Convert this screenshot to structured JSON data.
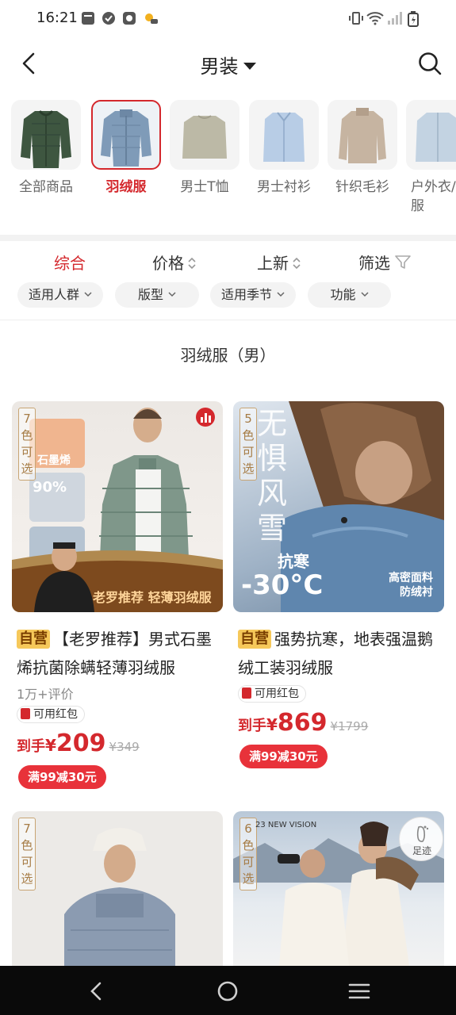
{
  "status_bar": {
    "time": "16:21"
  },
  "header": {
    "title": "男装"
  },
  "categories": [
    {
      "label": "全部商品",
      "active": false
    },
    {
      "label": "羽绒服",
      "active": true
    },
    {
      "label": "男士T恤",
      "active": false
    },
    {
      "label": "男士衬衫",
      "active": false
    },
    {
      "label": "针织毛衫",
      "active": false
    },
    {
      "label": "户外衣/晒服",
      "active": false
    }
  ],
  "sort": {
    "comprehensive": "综合",
    "price": "价格",
    "new": "上新",
    "filter": "筛选"
  },
  "filters": {
    "crowd": "适用人群",
    "fit": "版型",
    "season": "适用季节",
    "function": "功能"
  },
  "section_title": "羽绒服（男）",
  "products": [
    {
      "color_badge": "7色可选",
      "self_operated": "自营",
      "title": "【老罗推荐】男式石墨烯抗菌除螨轻薄羽绒服",
      "reviews": "1万+评价",
      "hongbao": "可用红包",
      "price_prefix": "到手",
      "currency": "¥",
      "price": "209",
      "original_price": "¥349",
      "coupon": "满99减30元",
      "overlay": {
        "graphene": "石墨烯",
        "down_pct": "90%",
        "banner": "老罗推荐 轻薄羽绒服"
      }
    },
    {
      "color_badge": "5色可选",
      "self_operated": "自营",
      "title": "强势抗寒，地表强温鹅绒工装羽绒服",
      "hongbao": "可用红包",
      "price_prefix": "到手",
      "currency": "¥",
      "price": "869",
      "original_price": "¥1799",
      "coupon": "满99减30元",
      "overlay": {
        "big": "无惧风雪",
        "cold": "抗寒",
        "temp": "-30°C",
        "fabric1": "高密面料",
        "fabric2": "防绒衬"
      }
    },
    {
      "color_badge": "7色可选"
    },
    {
      "color_badge": "6色可选",
      "overlay": {
        "vision": "23 NEW VISION"
      }
    }
  ],
  "footprint": "足迹",
  "colors": {
    "accent": "#d4282d",
    "coupon": "#e8323a",
    "badge": "#c8a574"
  }
}
